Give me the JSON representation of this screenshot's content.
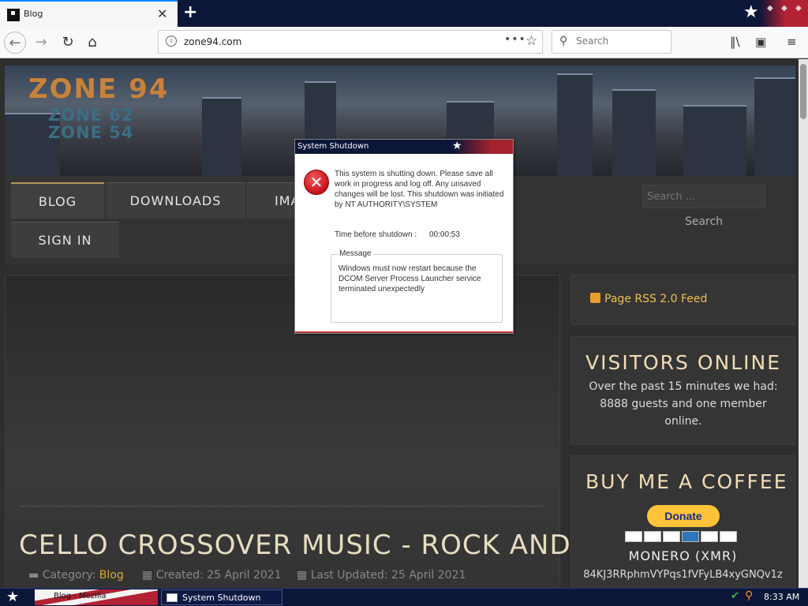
{
  "browser": {
    "tab_title": "Blog",
    "url": "zone94.com",
    "search_placeholder": "Search"
  },
  "site": {
    "logo": "ZONE 94",
    "logo_sub1": "ZONE 62",
    "logo_sub2": "ZONE 54",
    "menu": [
      "BLOG",
      "DOWNLOADS",
      "IMA",
      "SIGN IN"
    ],
    "search_placeholder": "Search ...",
    "search_button": "Search"
  },
  "article": {
    "title": "CELLO CROSSOVER MUSIC - ROCK AND METAL",
    "category_label": "Category:",
    "category": "Blog",
    "created": "Created: 25 April 2021",
    "updated": "Last Updated: 25 April 2021"
  },
  "sidebar": {
    "rss": "Page RSS 2.0 Feed",
    "visitors_title": "VISITORS ONLINE",
    "visitors_text": "Over the past 15 minutes we had: 8888 guests and one member online.",
    "coffee_title": "BUY ME A COFFEE",
    "donate": "Donate",
    "monero": "MONERO (XMR)",
    "address": "84KJ3RRphmVYPqs1fVFyLB4xyGNQv1z"
  },
  "dialog": {
    "title": "System Shutdown",
    "message": "This system is shutting down. Please save all work in progress and log off. Any unsaved changes will be lost. This shutdown was initiated by NT AUTHORITY\\SYSTEM",
    "time_label": "Time before shutdown :",
    "time_value": "00:00:53",
    "group_label": "Message",
    "group_text": "Windows must now restart because the DCOM Server Process Launcher service terminated unexpectedly"
  },
  "taskbar": {
    "item1": "Blog - Mozilla",
    "item2": "System Shutdown",
    "clock": "8:33 AM"
  },
  "colors": {
    "accent_gold": "#d9a940",
    "dialog_title_blue": "#0c1638",
    "error_red": "#c8101a"
  }
}
